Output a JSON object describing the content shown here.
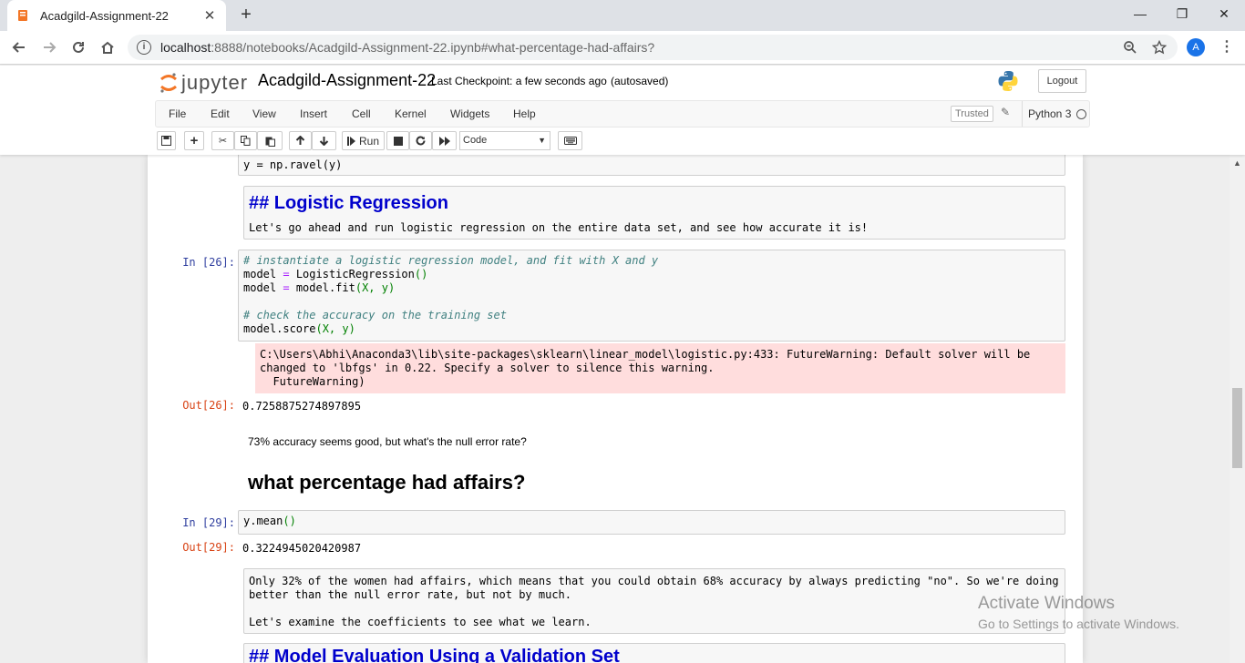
{
  "browser": {
    "tab_title": "Acadgild-Assignment-22",
    "tab_close": "✕",
    "new_tab": "+",
    "url_host": "localhost",
    "url_rest": ":8888/notebooks/Acadgild-Assignment-22.ipynb#what-percentage-had-affairs?",
    "avatar_letter": "A",
    "win_min": "—",
    "win_restore": "❐",
    "win_close": "✕"
  },
  "jupyter": {
    "logo_text": "jupyter",
    "notebook_name": "Acadgild-Assignment-22",
    "checkpoint": "Last Checkpoint: a few seconds ago",
    "autosave": "(autosaved)",
    "logout": "Logout",
    "menu": [
      "File",
      "Edit",
      "View",
      "Insert",
      "Cell",
      "Kernel",
      "Widgets",
      "Help"
    ],
    "trusted": "Trusted",
    "kernel": "Python 3",
    "run_label": "Run",
    "cell_type": "Code"
  },
  "cells": {
    "c0_code": "y = np.ravel(y)",
    "md1_raw_heading": "## Logistic Regression",
    "md1_raw_body": "Let's go ahead and run logistic regression on the entire data set, and see how accurate it is!",
    "c26_prompt": "In [26]:",
    "c26_line1": "# instantiate a logistic regression model, and fit with X and y",
    "c26_line2a": "model ",
    "c26_line2op": "=",
    "c26_line2b": " LogisticRegression",
    "c26_line2p": "()",
    "c26_line3a": "model ",
    "c26_line3op": "=",
    "c26_line3b": " model.fit",
    "c26_line3p": "(X, y)",
    "c26_line5": "# check the accuracy on the training set",
    "c26_line6a": "model.score",
    "c26_line6p": "(X, y)",
    "c26_stderr": "C:\\Users\\Abhi\\Anaconda3\\lib\\site-packages\\sklearn\\linear_model\\logistic.py:433: FutureWarning: Default solver will be changed to 'lbfgs' in 0.22. Specify a solver to silence this warning.\n  FutureWarning)",
    "c26_out_prompt": "Out[26]:",
    "c26_out": "0.7258875274897895",
    "para1": "73% accuracy seems good, but what's the null error rate?",
    "heading2": "what percentage had affairs?",
    "c29_prompt": "In [29]:",
    "c29_code_a": "y.mean",
    "c29_code_p": "()",
    "c29_out_prompt": "Out[29]:",
    "c29_out": "0.3224945020420987",
    "md3_raw": "Only 32% of the women had affairs, which means that you could obtain 68% accuracy by always predicting \"no\". So we're doing better than the null error rate, but not by much.\n\nLet's examine the coefficients to see what we learn.",
    "md4_raw_heading": "## Model Evaluation Using a Validation Set"
  },
  "watermark": {
    "line1": "Activate Windows",
    "line2": "Go to Settings to activate Windows."
  }
}
